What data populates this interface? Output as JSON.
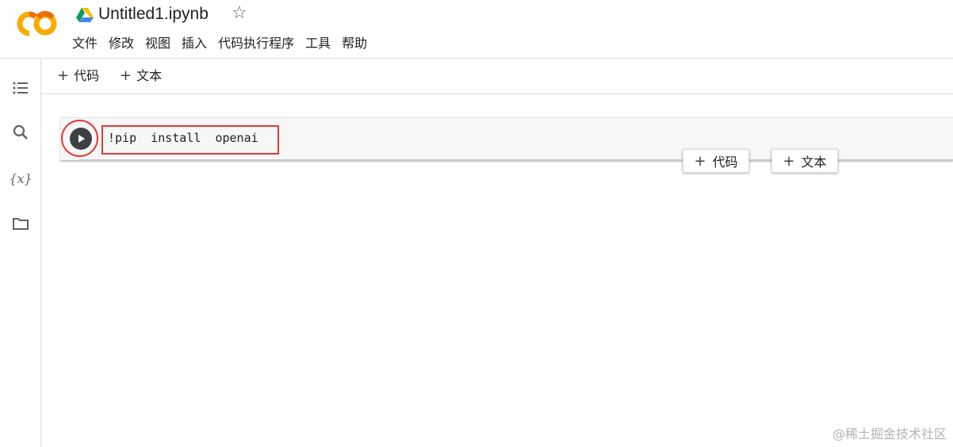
{
  "colors": {
    "accent_red": "#e53935",
    "logo_orange": "#f9ab00",
    "logo_dark_orange": "#e8710a",
    "icon_gray": "#5f6368"
  },
  "header": {
    "logo_icon": "colab-logo",
    "drive_icon": "google-drive-icon",
    "title": "Untitled1.ipynb",
    "star_glyph": "☆",
    "menu": [
      "文件",
      "修改",
      "视图",
      "插入",
      "代码执行程序",
      "工具",
      "帮助"
    ]
  },
  "sidebar": {
    "icons": [
      "table-of-contents-icon",
      "search-icon",
      "variables-icon",
      "folder-icon"
    ],
    "variables_label": "{x}"
  },
  "toolbar": {
    "add_code_label": "代码",
    "add_text_label": "文本",
    "plus_glyph": "+"
  },
  "cell": {
    "code": "!pip  install  openai",
    "run_icon": "play-icon"
  },
  "floating": {
    "add_code_label": "代码",
    "add_text_label": "文本",
    "plus_glyph": "+"
  },
  "watermark": "@稀土掘金技术社区"
}
